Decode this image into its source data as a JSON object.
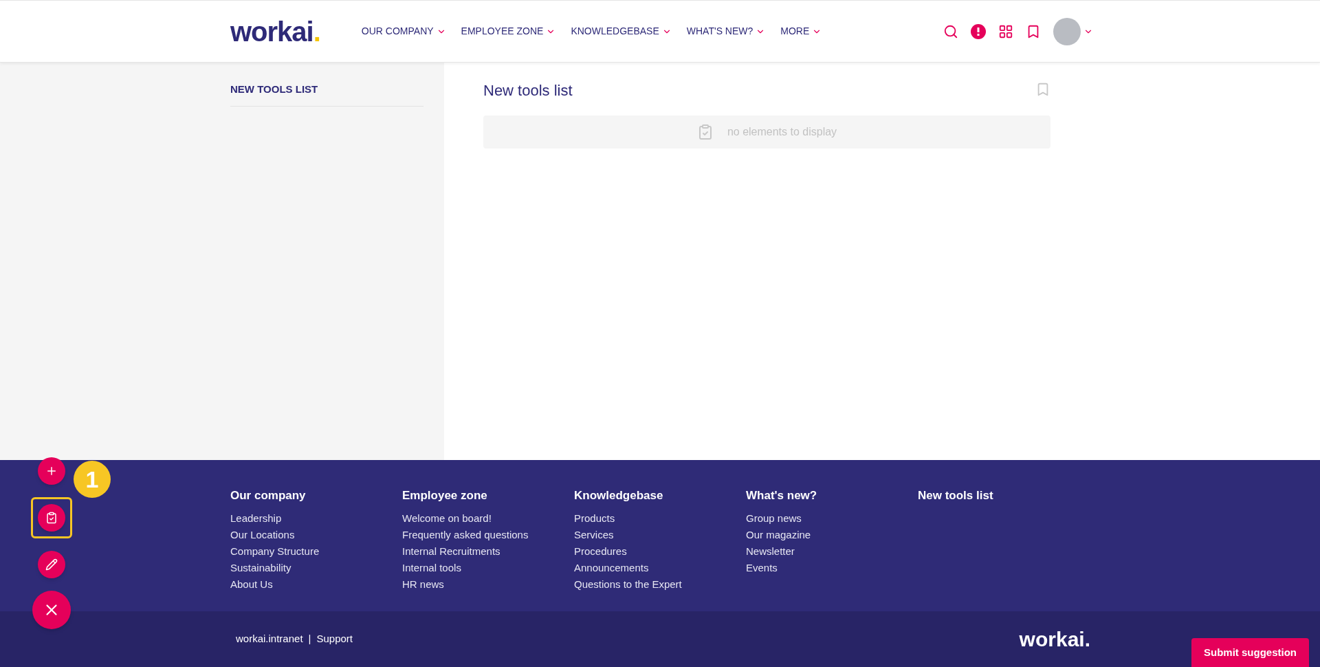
{
  "header": {
    "logo": {
      "text": "workai",
      "dot": "."
    },
    "nav": [
      {
        "label": "OUR COMPANY"
      },
      {
        "label": "EMPLOYEE ZONE"
      },
      {
        "label": "KNOWLEDGEBASE"
      },
      {
        "label": "WHAT'S NEW?"
      },
      {
        "label": "MORE"
      }
    ]
  },
  "sidebar": {
    "title": "NEW TOOLS LIST"
  },
  "content": {
    "title": "New tools list",
    "empty_message": "no elements to display"
  },
  "fab": {
    "badge": "1",
    "actions": [
      {
        "kind": "add",
        "highlighted": false
      },
      {
        "kind": "tasks",
        "highlighted": true
      },
      {
        "kind": "edit",
        "highlighted": false
      },
      {
        "kind": "close",
        "highlighted": false
      }
    ]
  },
  "footer": {
    "columns": [
      {
        "heading": "Our company",
        "links": [
          "Leadership",
          "Our Locations",
          "Company Structure",
          "Sustainability",
          "About Us"
        ]
      },
      {
        "heading": "Employee zone",
        "links": [
          "Welcome on board!",
          "Frequently asked questions",
          "Internal Recruitments",
          "Internal tools",
          "HR news"
        ]
      },
      {
        "heading": "Knowledgebase",
        "links": [
          "Products",
          "Services",
          "Procedures",
          "Announcements",
          "Questions to the Expert"
        ]
      },
      {
        "heading": "What's new?",
        "links": [
          "Group news",
          "Our magazine",
          "Newsletter",
          "Events"
        ]
      },
      {
        "heading": "New tools list"
      }
    ],
    "bottom": {
      "site": "workai.intranet",
      "separator": "|",
      "support": "Support",
      "logo": {
        "text": "workai",
        "dot": "."
      }
    },
    "submit_button": "Submit suggestion"
  }
}
